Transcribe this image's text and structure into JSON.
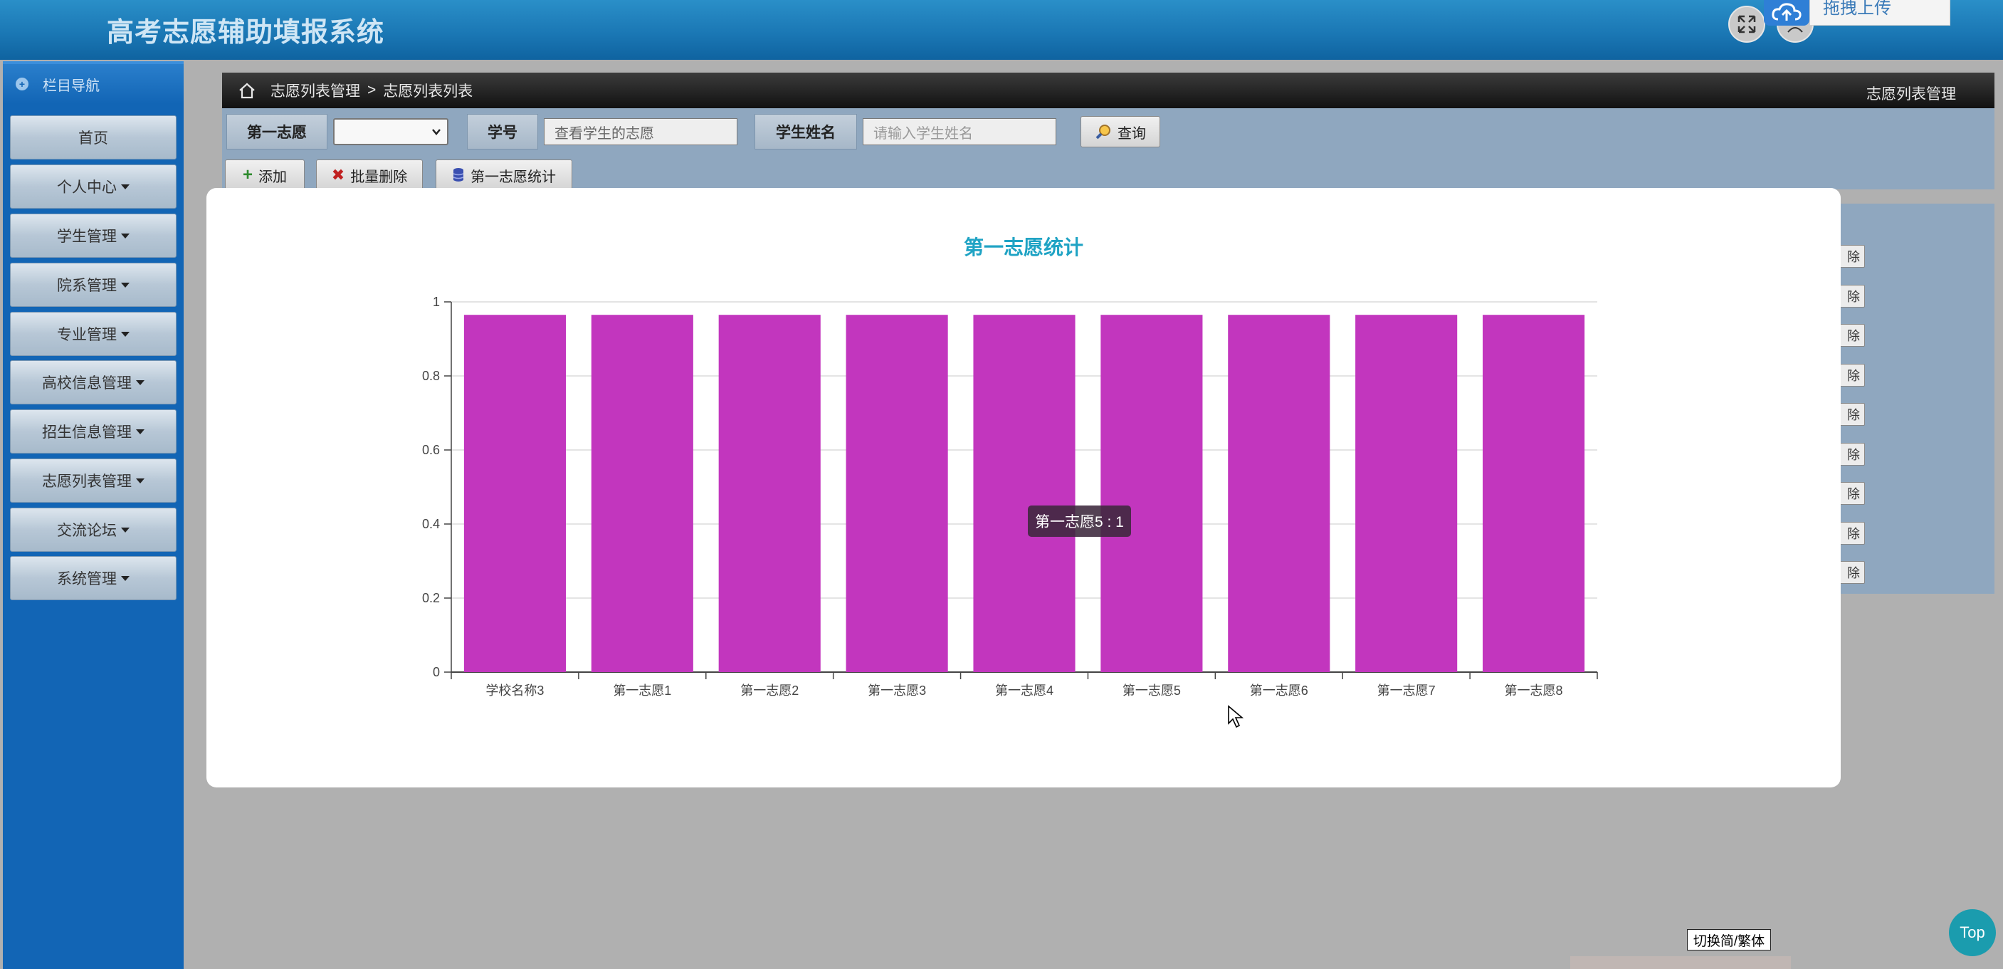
{
  "app": {
    "title": "高考志愿辅助填报系统",
    "upload_label": "拖拽上传"
  },
  "sidebar": {
    "header": "栏目导航",
    "items": [
      {
        "label": "首页",
        "has_caret": false
      },
      {
        "label": "个人中心",
        "has_caret": true
      },
      {
        "label": "学生管理",
        "has_caret": true
      },
      {
        "label": "院系管理",
        "has_caret": true
      },
      {
        "label": "专业管理",
        "has_caret": true
      },
      {
        "label": "高校信息管理",
        "has_caret": true
      },
      {
        "label": "招生信息管理",
        "has_caret": true
      },
      {
        "label": "志愿列表管理",
        "has_caret": true
      },
      {
        "label": "交流论坛",
        "has_caret": true
      },
      {
        "label": "系统管理",
        "has_caret": true
      }
    ]
  },
  "breadcrumb": {
    "level1": "志愿列表管理",
    "separator": ">",
    "level2": "志愿列表列表",
    "right_title": "志愿列表管理"
  },
  "search": {
    "first_choice_label": "第一志愿",
    "first_choice_value": "",
    "student_id_label": "学号",
    "student_id_value": "查看学生的志愿",
    "student_name_label": "学生姓名",
    "student_name_placeholder": "请输入学生姓名",
    "query_button": "查询"
  },
  "toolbar": {
    "add": "添加",
    "batch_delete": "批量删除",
    "stats": "第一志愿统计"
  },
  "table_remnant": {
    "row_button_fragment": "除",
    "row_count": 9
  },
  "tooltip": {
    "text": "第一志愿5 : 1"
  },
  "widgets": {
    "lang_toggle": "切换简/繁体",
    "top_button": "Top"
  },
  "colors": {
    "bar": "#c236be",
    "title": "#1fa3c4",
    "sidebar": "#1265b5"
  },
  "chart_data": {
    "type": "bar",
    "title": "第一志愿统计",
    "categories": [
      "学校名称3",
      "第一志愿1",
      "第一志愿2",
      "第一志愿3",
      "第一志愿4",
      "第一志愿5",
      "第一志愿6",
      "第一志愿7",
      "第一志愿8"
    ],
    "values": [
      1,
      1,
      1,
      1,
      1,
      1,
      1,
      1,
      1
    ],
    "ylim": [
      0,
      1
    ],
    "yticks": [
      "0",
      "0.2",
      "0.4",
      "0.6",
      "0.8",
      "1"
    ],
    "xlabel": "",
    "ylabel": "",
    "grid": true
  }
}
